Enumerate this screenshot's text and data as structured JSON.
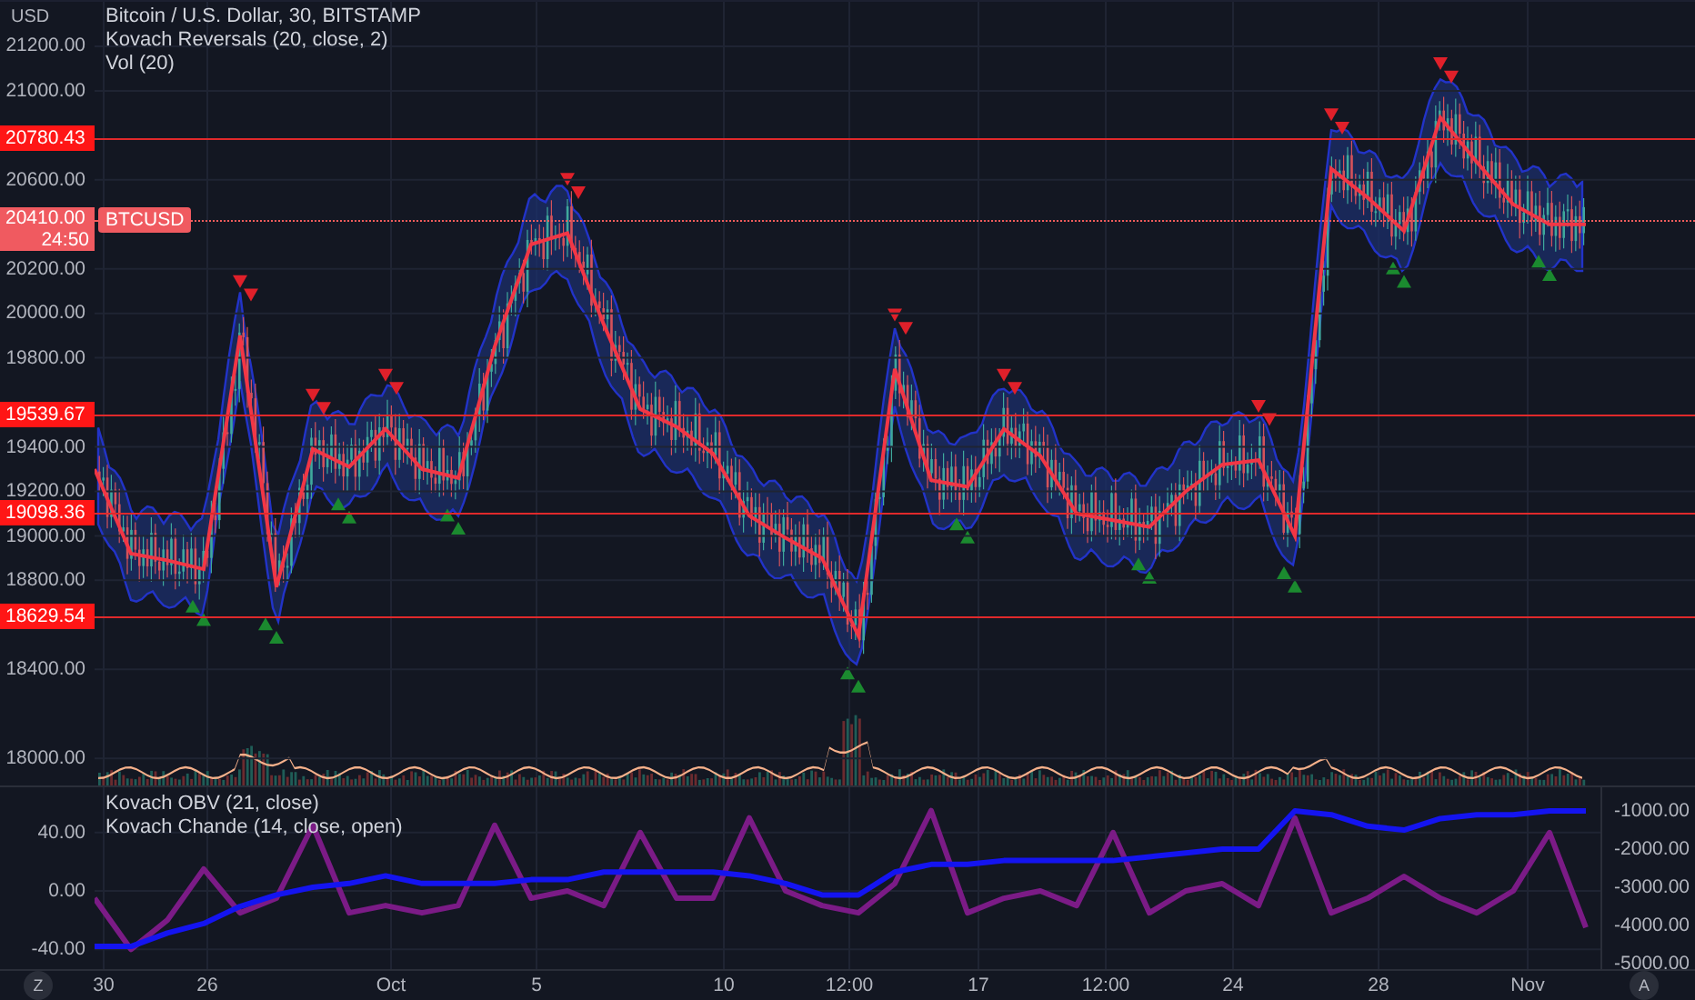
{
  "header": {
    "currency": "USD",
    "legend": [
      "Bitcoin / U.S. Dollar, 30, BITSTAMP",
      "Kovach Reversals (20, close, 2)",
      "Vol (20)"
    ]
  },
  "price_chart": {
    "chart_data": {
      "type": "line",
      "grid": true,
      "ylim": [
        17870,
        21400
      ],
      "yticks": [
        {
          "value": 21200,
          "label": "21200.00"
        },
        {
          "value": 21000,
          "label": "21000.00"
        },
        {
          "value": 20600,
          "label": "20600.00"
        },
        {
          "value": 20200,
          "label": "20200.00"
        },
        {
          "value": 20000,
          "label": "20000.00"
        },
        {
          "value": 19800,
          "label": "19800.00"
        },
        {
          "value": 19400,
          "label": "19400.00"
        },
        {
          "value": 19200,
          "label": "19200.00"
        },
        {
          "value": 19000,
          "label": "19000.00"
        },
        {
          "value": 18800,
          "label": "18800.00"
        },
        {
          "value": 18400,
          "label": "18400.00"
        },
        {
          "value": 18000,
          "label": "18000.00"
        }
      ],
      "series": [
        {
          "color": "#f23645",
          "values": [
            19300,
            18920,
            18890,
            18850,
            19900,
            18770,
            19390,
            19310,
            19480,
            19300,
            19260,
            19850,
            20310,
            20360,
            19950,
            19570,
            19490,
            19370,
            19090,
            18990,
            18900,
            18550,
            19750,
            19250,
            19220,
            19480,
            19360,
            19100,
            19070,
            19040,
            19200,
            19320,
            19340,
            19000,
            20650,
            20520,
            20370,
            20880,
            20680,
            20490,
            20400,
            20400
          ]
        }
      ]
    }
  },
  "levels": [
    {
      "price": "20780.43"
    },
    {
      "price": "19539.67"
    },
    {
      "price": "19098.36"
    },
    {
      "price": "18629.54"
    }
  ],
  "last_price": {
    "price": "20410.00",
    "countdown": "24:50",
    "symbol": "BTCUSD"
  },
  "lower_pane": {
    "legend": [
      "Kovach OBV (21, close)",
      "Kovach Chande (14, close, open)"
    ],
    "chart_data": {
      "type": "line",
      "grid": true,
      "ylim": [
        -56,
        71
      ],
      "yticks": [
        {
          "value": 40,
          "label": "40.00"
        },
        {
          "value": 0,
          "label": "0.00"
        },
        {
          "value": -40,
          "label": "-40.00"
        }
      ],
      "series": [
        {
          "color": "#7b1b86",
          "values": [
            -5,
            -40,
            -20,
            15,
            -15,
            -5,
            45,
            -15,
            -10,
            -15,
            -10,
            45,
            -5,
            0,
            -10,
            40,
            -5,
            -5,
            50,
            0,
            -10,
            -15,
            5,
            55,
            -15,
            -5,
            0,
            -10,
            40,
            -15,
            0,
            5,
            -10,
            50,
            -15,
            -5,
            10,
            -5,
            -15,
            0,
            40,
            -25
          ]
        }
      ]
    },
    "obv": {
      "chart_data": {
        "type": "line",
        "ylim": [
          -5190,
          -333
        ],
        "yticks": [
          {
            "value": -1000,
            "label": "-1000.00"
          },
          {
            "value": -2000,
            "label": "-2000.00"
          },
          {
            "value": -3000,
            "label": "-3000.00"
          },
          {
            "value": -4000,
            "label": "-4000.00"
          },
          {
            "value": -5000,
            "label": "-5000.00"
          }
        ],
        "series": [
          {
            "color": "#1414f0",
            "values": [
              -4550,
              -4550,
              -4200,
              -3950,
              -3500,
              -3200,
              -3000,
              -2900,
              -2700,
              -2900,
              -2900,
              -2900,
              -2800,
              -2800,
              -2600,
              -2600,
              -2600,
              -2600,
              -2700,
              -2900,
              -3200,
              -3200,
              -2600,
              -2400,
              -2400,
              -2300,
              -2300,
              -2300,
              -2300,
              -2200,
              -2100,
              -2000,
              -2000,
              -1000,
              -1100,
              -1400,
              -1500,
              -1200,
              -1100,
              -1100,
              -1000,
              -1000
            ]
          }
        ]
      }
    }
  },
  "time_axis": {
    "labels": [
      "30",
      "26",
      "Oct",
      "5",
      "10",
      "12:00",
      "17",
      "12:00",
      "24",
      "28",
      "Nov"
    ]
  },
  "buttons": [
    {
      "label": "Z"
    },
    {
      "label": "A"
    }
  ]
}
